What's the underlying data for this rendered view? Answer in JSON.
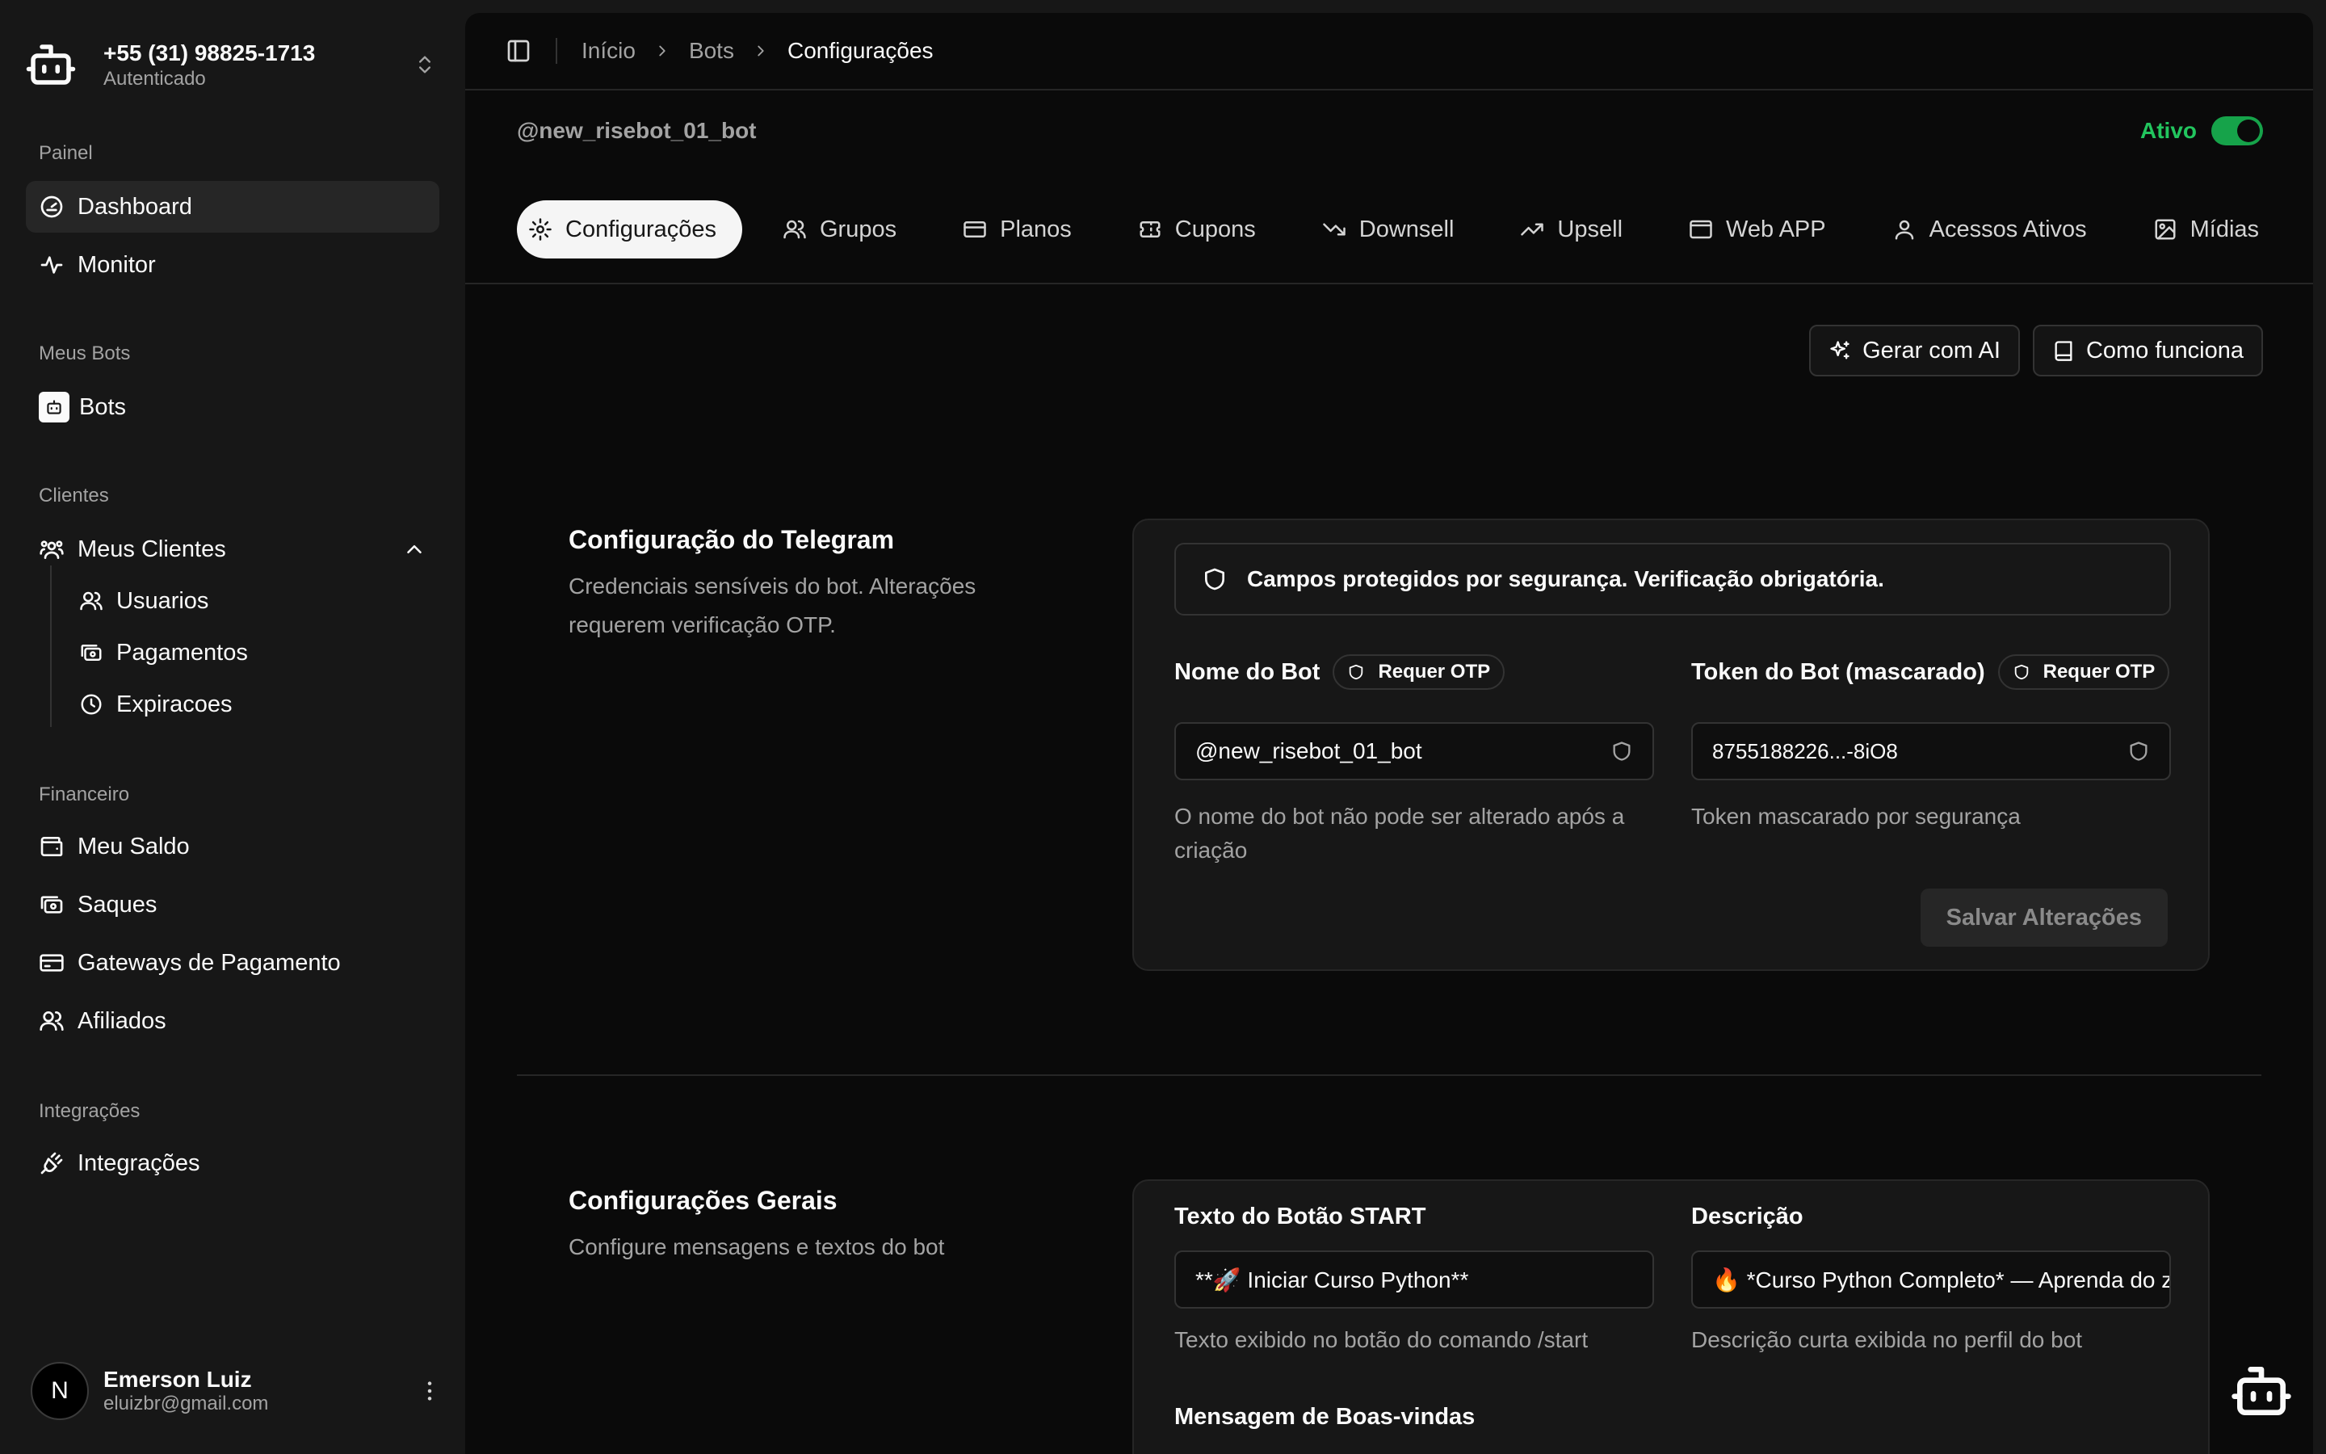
{
  "account": {
    "phone": "+55 (31) 98825-1713",
    "status": "Autenticado"
  },
  "sidebar": {
    "groups": {
      "painel": "Painel",
      "meus_bots": "Meus Bots",
      "clientes": "Clientes",
      "financeiro": "Financeiro",
      "integracoes": "Integrações"
    },
    "items": {
      "dashboard": "Dashboard",
      "monitor": "Monitor",
      "bots": "Bots",
      "meus_clientes": "Meus Clientes",
      "usuarios": "Usuarios",
      "pagamentos": "Pagamentos",
      "expiracoes": "Expiracoes",
      "meu_saldo": "Meu Saldo",
      "saques": "Saques",
      "gateways": "Gateways de Pagamento",
      "afiliados": "Afiliados",
      "integracoes": "Integrações"
    }
  },
  "user": {
    "initial": "N",
    "name": "Emerson Luiz",
    "email": "eluizbr@gmail.com"
  },
  "breadcrumb": [
    "Início",
    "Bots",
    "Configurações"
  ],
  "bot": {
    "handle": "@new_risebot_01_bot",
    "status_label": "Ativo",
    "active": true
  },
  "tabs": [
    "Configurações",
    "Grupos",
    "Planos",
    "Cupons",
    "Downsell",
    "Upsell",
    "Web APP",
    "Acessos Ativos",
    "Mídias"
  ],
  "actions": {
    "ai": "Gerar com AI",
    "how": "Como funciona"
  },
  "telegram": {
    "title": "Configuração do Telegram",
    "desc": "Credenciais sensíveis do bot. Alterações requerem verificação OTP.",
    "notice": "Campos protegidos por segurança. Verificação obrigatória.",
    "name_label": "Nome do Bot",
    "name_badge": "Requer OTP",
    "name_value": "@new_risebot_01_bot",
    "name_help": "O nome do bot não pode ser alterado após a criação",
    "token_label": "Token do Bot (mascarado)",
    "token_badge": "Requer OTP",
    "token_value": "8755188226...-8iO8",
    "token_help": "Token mascarado por segurança",
    "save": "Salvar Alterações"
  },
  "general": {
    "title": "Configurações Gerais",
    "desc": "Configure mensagens e textos do bot",
    "start_label": "Texto do Botão START",
    "start_value": "**🚀 Iniciar Curso Python**",
    "start_help": "Texto exibido no botão do comando /start",
    "desc_label": "Descrição",
    "desc_value": "🔥 *Curso Python Completo* — Aprenda do zero",
    "desc_help": "Descrição curta exibida no perfil do bot",
    "welcome_label": "Mensagem de Boas-vindas"
  },
  "colors": {
    "accent_green": "#22c55e",
    "toggle_green": "#16a34a",
    "bg": "#0a0a0a",
    "sidebar_bg": "#171717"
  }
}
